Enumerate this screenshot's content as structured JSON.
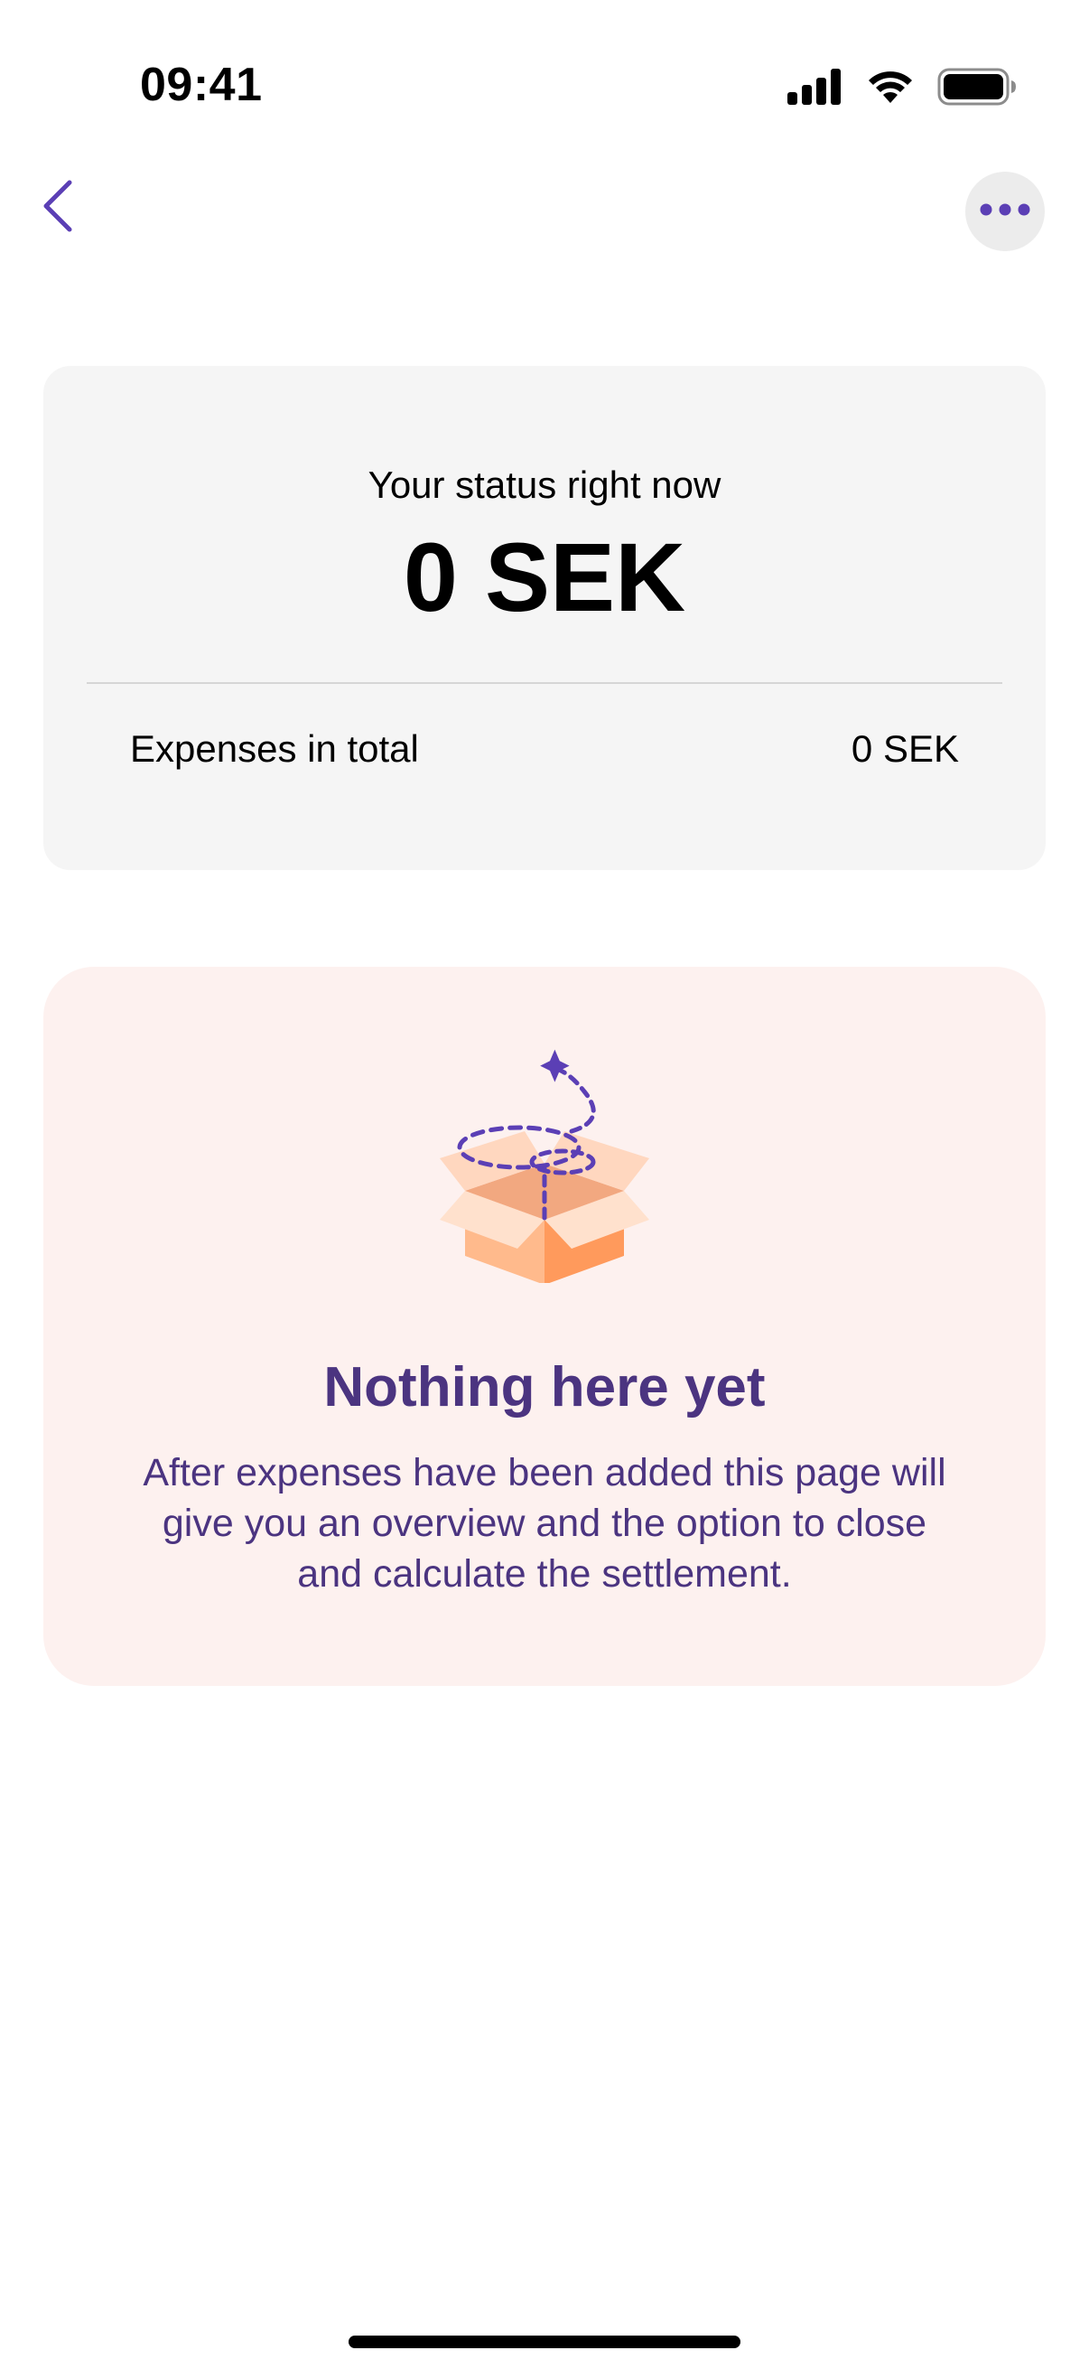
{
  "status_bar": {
    "time": "09:41",
    "icons": [
      "cellular-signal-icon",
      "wifi-icon",
      "battery-icon"
    ]
  },
  "nav": {
    "back_icon": "chevron-left-icon",
    "more_icon": "ellipsis-icon"
  },
  "status_card": {
    "label": "Your status right now",
    "amount": "0 SEK",
    "expenses_label": "Expenses in total",
    "expenses_value": "0 SEK"
  },
  "empty_state": {
    "illustration": "open-box-icon",
    "title": "Nothing here yet",
    "description": "After expenses have been added this page will give you an overview and the option to close and calculate the settlement."
  },
  "colors": {
    "accent": "#5b3fb5",
    "empty_text": "#4b3480",
    "status_card_bg": "#f5f5f5",
    "empty_card_bg": "#fdf1ef",
    "more_button_bg": "#ececec",
    "box_light": "#ffc7a6",
    "box_dark": "#ff9a5c"
  }
}
